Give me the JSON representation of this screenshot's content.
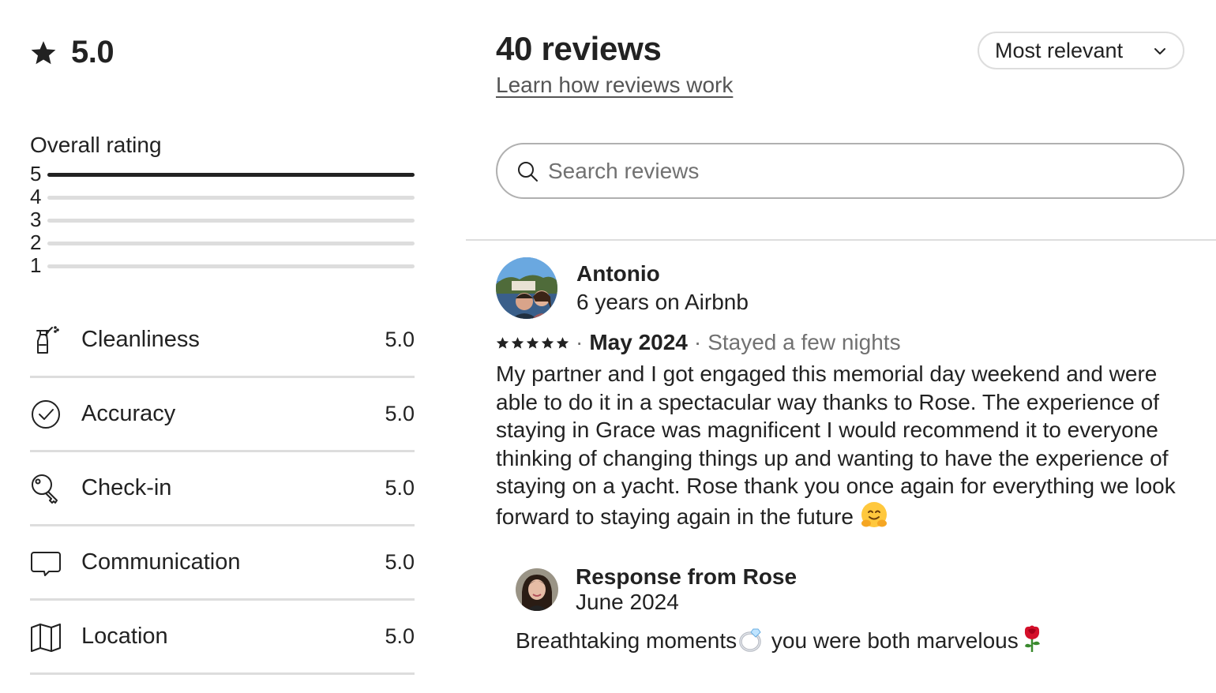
{
  "overall": {
    "score": "5.0",
    "icon": "star-icon"
  },
  "distribution": {
    "title": "Overall rating",
    "rows": [
      {
        "stars": "5",
        "fraction": 1.0
      },
      {
        "stars": "4",
        "fraction": 0.0
      },
      {
        "stars": "3",
        "fraction": 0.0
      },
      {
        "stars": "2",
        "fraction": 0.0
      },
      {
        "stars": "1",
        "fraction": 0.0
      }
    ]
  },
  "categories": [
    {
      "label": "Cleanliness",
      "value": "5.0",
      "icon": "spray-bottle-icon"
    },
    {
      "label": "Accuracy",
      "value": "5.0",
      "icon": "check-circle-icon"
    },
    {
      "label": "Check-in",
      "value": "5.0",
      "icon": "key-icon"
    },
    {
      "label": "Communication",
      "value": "5.0",
      "icon": "chat-bubble-icon"
    },
    {
      "label": "Location",
      "value": "5.0",
      "icon": "map-icon"
    }
  ],
  "header": {
    "count": "40 reviews",
    "learn_link": "Learn how reviews work",
    "sort_label": "Most relevant"
  },
  "search": {
    "placeholder": "Search reviews"
  },
  "review": {
    "author": "Antonio",
    "tenure": "6 years on Airbnb",
    "rating": 5,
    "date": "May 2024",
    "stay": "Stayed a few nights",
    "text": "My partner and I got engaged this memorial day weekend and were able to do it in a spectacular way thanks to Rose. The experience of staying in Grace was magnificent I would recommend it to everyone thinking of changing things up and wanting to have the experience of staying on a yacht. Rose thank you once again for everything we look forward to staying again in the future",
    "emoji": "hugging-face",
    "response": {
      "title": "Response from Rose",
      "date": "June 2024",
      "text_part1": "Breathtaking moments",
      "text_part2": " you were both marvelous",
      "emoji1": "ring",
      "emoji2": "rose"
    }
  },
  "colors": {
    "text": "#222222",
    "muted": "#717171",
    "border": "#dddddd",
    "bar_fill": "#222222"
  }
}
